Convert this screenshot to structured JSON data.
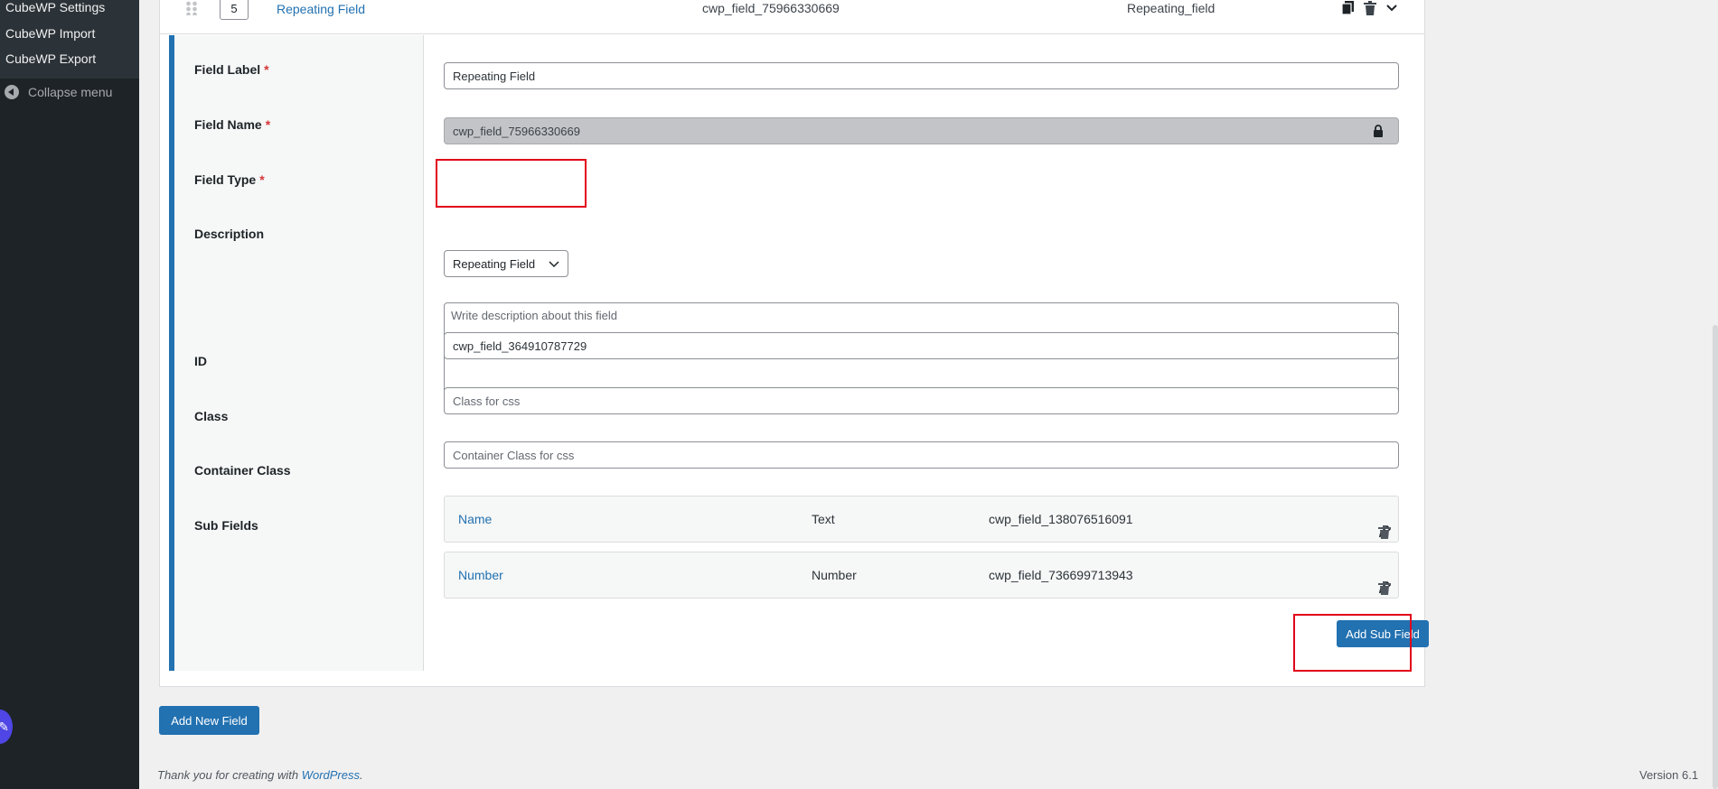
{
  "sidebar": {
    "items": [
      {
        "label": "CubeWP Settings"
      },
      {
        "label": "CubeWP Import"
      },
      {
        "label": "CubeWP Export"
      }
    ],
    "collapse_label": "Collapse menu"
  },
  "field": {
    "order": "5",
    "label": "Repeating Field",
    "name": "cwp_field_75966330669",
    "type": "Repeating_field"
  },
  "form": {
    "field_label": {
      "label": "Field Label",
      "required": "*",
      "value": "Repeating Field"
    },
    "field_name": {
      "label": "Field Name",
      "required": "*",
      "value": "cwp_field_75966330669"
    },
    "field_type": {
      "label": "Field Type",
      "required": "*",
      "value": "Repeating Field"
    },
    "description": {
      "label": "Description",
      "placeholder": "Write description about this field"
    },
    "id": {
      "label": "ID",
      "value": "cwp_field_364910787729"
    },
    "class": {
      "label": "Class",
      "placeholder": "Class for css"
    },
    "container_class": {
      "label": "Container Class",
      "placeholder": "Container Class for css"
    },
    "sub_fields": {
      "label": "Sub Fields",
      "rows": [
        {
          "label": "Name",
          "type": "Text",
          "name": "cwp_field_138076516091"
        },
        {
          "label": "Number",
          "type": "Number",
          "name": "cwp_field_736699713943"
        }
      ],
      "add_button": "Add Sub Field"
    }
  },
  "add_new_field_button": "Add New Field",
  "footer": {
    "thanks_prefix": "Thank you for creating with ",
    "wordpress_link": "WordPress",
    "thanks_suffix": ".",
    "version": "Version 6.1"
  },
  "colors": {
    "accent": "#2271b1",
    "highlight": "#e2001a",
    "sidebar_bg": "#1d2327"
  }
}
